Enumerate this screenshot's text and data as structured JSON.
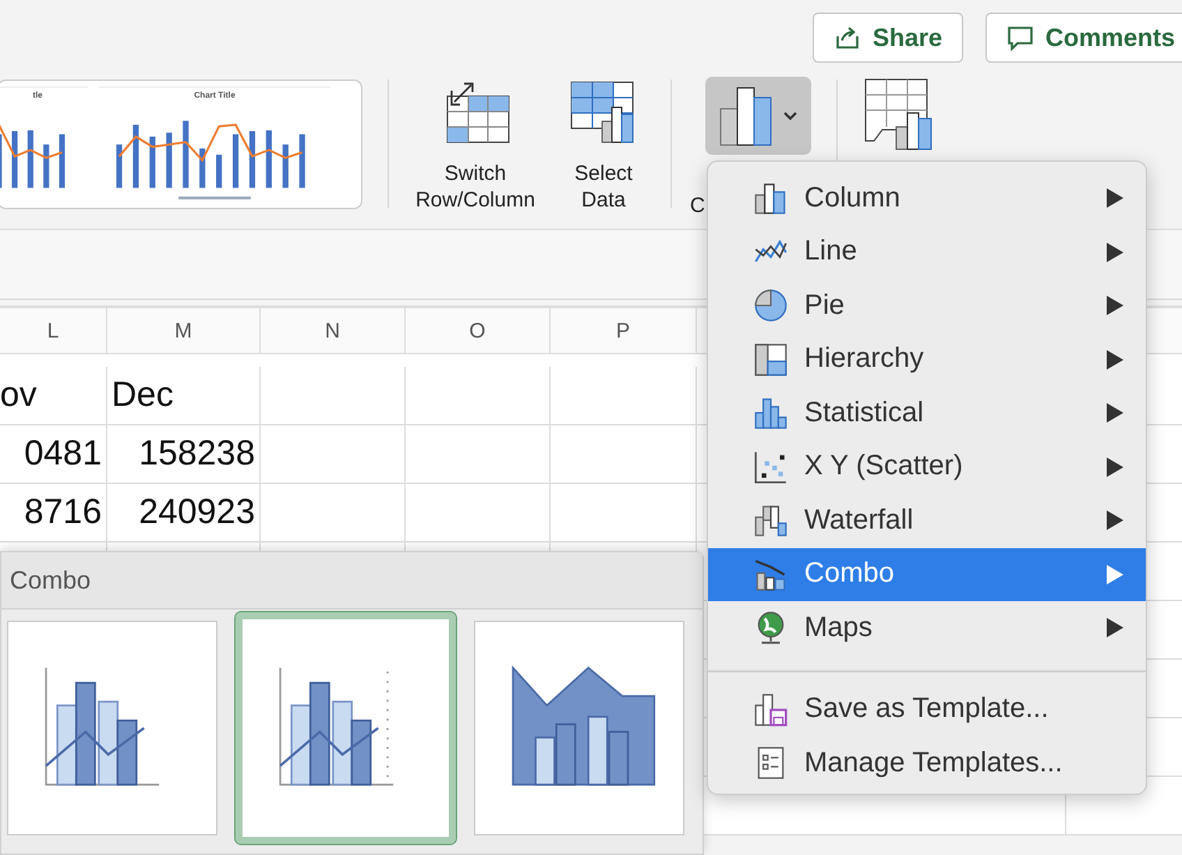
{
  "top_bar": {
    "buttons": [
      {
        "label": "Share",
        "kind": "share"
      },
      {
        "label": "Comments",
        "kind": "comments"
      }
    ]
  },
  "ribbon": {
    "style_thumbnails": [
      {
        "title": "tle"
      },
      {
        "title": "Chart Title"
      }
    ],
    "buttons": [
      {
        "label": "Switch Row/Column"
      },
      {
        "label": "Select Data"
      }
    ],
    "chart_type_button": {
      "label": "C",
      "pressed": true
    }
  },
  "sheet": {
    "columns": [
      "L",
      "M",
      "N",
      "O",
      "P"
    ],
    "rows": [
      {
        "kind": "header",
        "cells": [
          "ov",
          "Dec"
        ]
      },
      {
        "kind": "values",
        "cells": [
          "0481",
          "158238"
        ]
      },
      {
        "kind": "values",
        "cells": [
          "8716",
          "240923"
        ]
      }
    ]
  },
  "combo_gallery": {
    "title": "Combo",
    "thumbnails": [
      {
        "selected": false
      },
      {
        "selected": true
      },
      {
        "selected": false
      }
    ]
  },
  "menu": {
    "chart_types": [
      {
        "label": "Column",
        "selected": false
      },
      {
        "label": "Line",
        "selected": false
      },
      {
        "label": "Pie",
        "selected": false
      },
      {
        "label": "Hierarchy",
        "selected": false
      },
      {
        "label": "Statistical",
        "selected": false
      },
      {
        "label": "X Y (Scatter)",
        "selected": false
      },
      {
        "label": "Waterfall",
        "selected": false
      },
      {
        "label": "Combo",
        "selected": true
      },
      {
        "label": "Maps",
        "selected": false
      }
    ],
    "template_items": [
      {
        "label": "Save as Template..."
      },
      {
        "label": "Manage Templates..."
      }
    ]
  }
}
